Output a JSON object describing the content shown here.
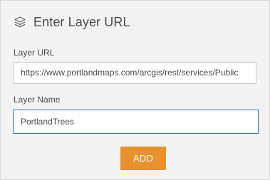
{
  "header": {
    "icon": "layers-icon",
    "title": "Enter Layer URL"
  },
  "layer_url": {
    "label": "Layer URL",
    "value": "https://www.portlandmaps.com/arcgis/rest/services/Public"
  },
  "layer_name": {
    "label": "Layer Name",
    "value": "PortlandTrees"
  },
  "add_button": {
    "label": "ADD",
    "color": "#e8922f"
  },
  "colors": {
    "panel_background": "#f3f3f3",
    "text": "#4a4a4a",
    "focus_border": "#3b6f9a"
  }
}
